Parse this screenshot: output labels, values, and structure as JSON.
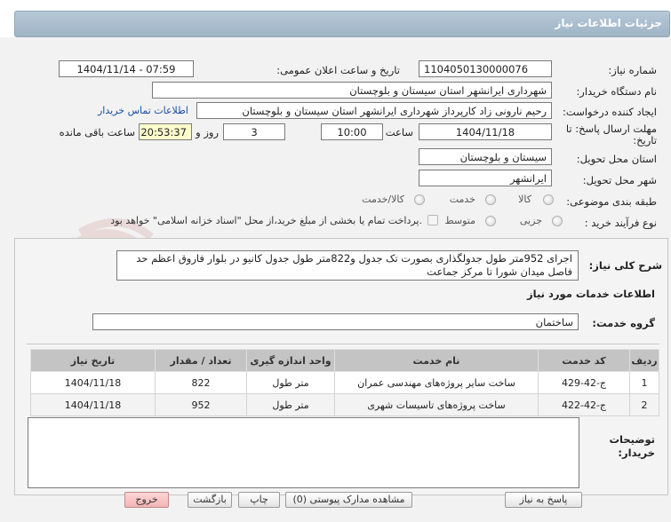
{
  "header": {
    "title": "جزئیات اطلاعات نیاز"
  },
  "form": {
    "need_number_label": "شماره نیاز:",
    "need_number": "1104050130000076",
    "announce_label": "تاریخ و ساعت اعلان عمومی:",
    "announce_value": "1404/11/14 - 07:59",
    "buyer_org_label": "نام دستگاه خریدار:",
    "buyer_org": "شهرداری ایرانشهر استان سیستان و بلوچستان",
    "creator_label": "ایجاد کننده درخواست:",
    "creator": "رحیم نارونی زاد کارپرداز شهرداری ایرانشهر استان سیستان و بلوچستان",
    "contact_link": "اطلاعات تماس خریدار",
    "deadline_label_1": "مهلت ارسال پاسخ: تا",
    "deadline_label_2": "تاریخ:",
    "deadline_date": "1404/11/18",
    "time_label": "ساعت",
    "deadline_time": "10:00",
    "days_value": "3",
    "days_label": "روز و",
    "remaining_time": "20:53:37",
    "remaining_label": "ساعت باقی مانده",
    "province_label": "استان محل تحویل:",
    "province": "سیستان و بلوچستان",
    "city_label": "شهر محل تحویل:",
    "city": "ایرانشهر",
    "category_label": "طبقه بندی موضوعی:",
    "category_options": [
      "کالا",
      "خدمت",
      "کالا/خدمت"
    ],
    "process_label": "نوع فرآیند خرید :",
    "process_options": [
      "جزیی",
      "متوسط"
    ],
    "payment_note": "پرداخت تمام یا بخشی از مبلغ خرید،از محل \"اسناد خزانه اسلامی\" خواهد بود."
  },
  "details": {
    "summary_label": "شرح کلی نیاز:",
    "summary": "اجرای 952متر طول جدولگذاری بصورت تک جدول و822متر طول جدول کانیو در بلوار فاروق اعظم حد فاصل میدان شورا تا مرکز جماعت",
    "services_title": "اطلاعات خدمات مورد نیاز",
    "service_group_label": "گروه خدمت:",
    "service_group": "ساختمان",
    "table": {
      "headers": [
        "ردیف",
        "کد خدمت",
        "نام خدمت",
        "واحد اندازه گیری",
        "تعداد / مقدار",
        "تاریخ نیاز"
      ],
      "rows": [
        [
          "1",
          "ج-42-429",
          "ساخت سایر پروژه‌های مهندسی عمران",
          "متر طول",
          "822",
          "1404/11/18"
        ],
        [
          "2",
          "ج-42-422",
          "ساخت پروژه‌های تاسیسات شهری",
          "متر طول",
          "952",
          "1404/11/18"
        ]
      ]
    },
    "buyer_notes_label_1": "توضیحات",
    "buyer_notes_label_2": "خریدار:",
    "buyer_notes": ""
  },
  "buttons": {
    "reply": "پاسخ به نیاز",
    "attachments": "مشاهده مدارک پیوستی (0)",
    "print": "چاپ",
    "back": "بازگشت",
    "exit": "خروج"
  },
  "watermark": {
    "text": "AriaTender.net"
  },
  "colors": {
    "header": "#a9bdd0",
    "accent_link": "#1a4fa0",
    "exit_button": "#f3b4b4",
    "remaining_bg": "#ffffcc"
  }
}
